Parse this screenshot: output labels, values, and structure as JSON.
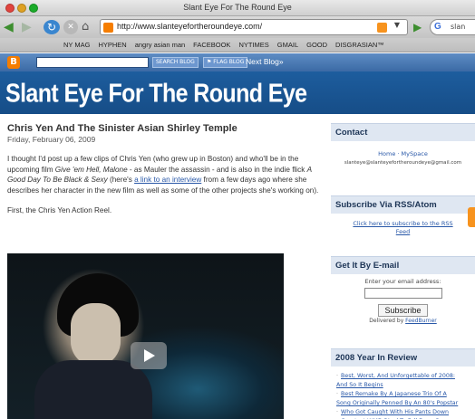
{
  "browser": {
    "window_title": "Slant Eye For The Round Eye",
    "url": "http://www.slanteyefortheroundeye.com/",
    "search_placeholder": "slan",
    "bookmarks": [
      "NY MAG",
      "HYPHEN",
      "angry asian man",
      "FACEBOOK",
      "NYTIMES",
      "GMAIL",
      "GOOD",
      "DISGRASIAN™"
    ]
  },
  "blogger_bar": {
    "search_blog": "SEARCH BLOG",
    "flag_blog": "⚑ FLAG BLOG",
    "next_blog": "Next Blog»"
  },
  "blog": {
    "title": "Slant Eye For The Round Eye"
  },
  "post": {
    "title": "Chris Yen And The Sinister Asian Shirley Temple",
    "date": "Friday, February 06, 2009",
    "p1_a": "I thought I'd post up a few clips of Chris Yen (who grew up in Boston) and who'll be in the upcoming film ",
    "p1_film1": "Give 'em Hell, Malone",
    "p1_b": " - as Mauler the assassin - and is also in the indie flick ",
    "p1_film2": "A Good Day To Be Black & Sexy",
    "p1_c": " (here's ",
    "p1_link": "a link to an interview",
    "p1_d": " from a few days ago where she describes her character in the new film as well as some of the other projects she's working on).",
    "p2": "First, the Chris Yen Action Reel."
  },
  "sidebar": {
    "contact": {
      "heading": "Contact",
      "links": "Home · MySpace",
      "email": "slanteye@slanteyefortheroundeye@gmail.com"
    },
    "rss": {
      "heading": "Subscribe Via RSS/Atom",
      "link": "Click here to subscribe to the RSS Feed"
    },
    "email_sub": {
      "heading": "Get It By E-mail",
      "label": "Enter your email address:",
      "button": "Subscribe",
      "delivered_by": "Delivered by",
      "provider": "FeedBurner"
    },
    "review": {
      "heading": "2008 Year In Review",
      "items": [
        "Best, Worst, And Unforgettable of 2008:",
        "And So It Begins",
        "Best Remake By A Japanese Trio Of A",
        "Song Originally Penned By An 80's Popstar",
        "Who Got Caught With His Pants Down",
        "Greatest WMD Rival To Fall From Grace"
      ]
    }
  }
}
